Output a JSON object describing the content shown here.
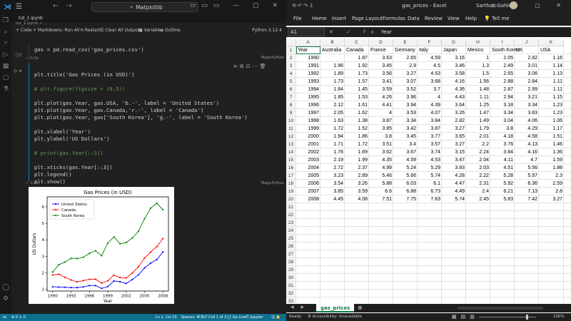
{
  "vscode": {
    "title_search": "Matplotlib",
    "tabs": [
      "tut_1.ipynb",
      "tut_1.ipynb > ..."
    ],
    "toolbar": [
      "+ Code",
      "+ Markdown",
      "▷ Run All",
      "⟲ Restart",
      "☰ Clear All Outputs",
      "▦ Variables",
      "≡ Outline",
      "Python 3.12.4"
    ],
    "cell1": {
      "index": "[2]",
      "lines": [
        "gas = pd.read_csv('gas_prices.csv')"
      ],
      "status": "✓ 0.0s",
      "lang": "MagicPython"
    },
    "cell2": {
      "index": "[3]",
      "lines": [
        "plt.title('Gas Prices (in USD)')",
        "",
        "# plt.figure(figsize = (8,5))",
        "",
        "plt.plot(gas.Year, gas.USA, 'b.-', label = 'United States')",
        "plt.plot(gas.Year, gas.Canada,'r.-', label = 'Canada')",
        "plt.plot(gas.Year, gas['South Korea'], 'g.-', label = 'South Korea')",
        "",
        "plt.xlabel('Year')",
        "plt.ylabel('US Dollars')",
        "",
        "# print(gas.Year[::3])",
        "",
        "plt.xticks(gas.Year[::3])",
        "plt.legend()",
        "plt.show()"
      ],
      "status": "✓ 0.0s",
      "lang": "MagicPython"
    },
    "statusbar": [
      "⊗ 0  ⚠ 0",
      "Ln 1, Col 15",
      "Spaces: 4",
      "CRLF",
      "Cell 1 of 2",
      "{} Go Live",
      "Ⓟ Jupyter",
      "☺ 🔔"
    ]
  },
  "chart_data": {
    "type": "line",
    "title": "Gas Prices (in USD)",
    "xlabel": "Year",
    "ylabel": "US Dollars",
    "x": [
      1990,
      1991,
      1992,
      1993,
      1994,
      1995,
      1996,
      1997,
      1998,
      1999,
      2000,
      2001,
      2002,
      2003,
      2004,
      2005,
      2006,
      2007,
      2008
    ],
    "xticks": [
      1990,
      1993,
      1996,
      1999,
      2002,
      2005,
      2008
    ],
    "yticks": [
      1,
      2,
      3,
      4,
      5,
      6
    ],
    "xlim": [
      1989.1,
      2008.9
    ],
    "ylim": [
      0.9,
      6.6
    ],
    "legend_position": "top-left",
    "grid": false,
    "series": [
      {
        "name": "United States",
        "color": "#0000ff",
        "values": [
          1.16,
          1.14,
          1.13,
          1.11,
          1.11,
          1.15,
          1.23,
          1.23,
          1.06,
          1.17,
          1.51,
          1.46,
          1.36,
          1.59,
          1.88,
          2.3,
          2.59,
          2.8,
          3.27
        ]
      },
      {
        "name": "Canada",
        "color": "#ff0000",
        "values": [
          1.87,
          1.92,
          1.73,
          1.57,
          1.45,
          1.53,
          1.61,
          1.62,
          1.38,
          1.52,
          1.86,
          1.72,
          1.69,
          1.99,
          2.37,
          2.89,
          3.26,
          3.59,
          4.08
        ]
      },
      {
        "name": "South Korea",
        "color": "#008000",
        "values": [
          2.05,
          2.49,
          2.65,
          2.88,
          2.87,
          2.94,
          3.18,
          3.34,
          3.04,
          3.8,
          4.18,
          3.76,
          3.84,
          4.11,
          4.51,
          5.28,
          5.92,
          6.21,
          5.83
        ]
      }
    ]
  },
  "excel": {
    "title": "gas_prices  -  Excel",
    "user": "Sarthak Gahlot",
    "quick_access": "⟲  ↶  ↷  ⇩",
    "ribbon": [
      "File",
      "Home",
      "Insert",
      "Page Layout",
      "Formulas",
      "Data",
      "Review",
      "View",
      "Help",
      "💡 Tell me"
    ],
    "name_box": "A1",
    "formula_icons": "✕ ✓ fx",
    "formula_value": "Year",
    "columns": [
      "A",
      "B",
      "C",
      "D",
      "E",
      "F",
      "G",
      "H",
      "I",
      "J",
      "K"
    ],
    "headers": [
      "Year",
      "Australia",
      "Canada",
      "France",
      "Germany",
      "Italy",
      "Japan",
      "Mexico",
      "South Korea",
      "UK",
      "USA"
    ],
    "rows": [
      [
        "1990",
        "",
        "1.87",
        "3.63",
        "2.65",
        "4.59",
        "3.16",
        "1",
        "2.05",
        "2.82",
        "1.16"
      ],
      [
        "1991",
        "1.96",
        "1.92",
        "3.45",
        "2.9",
        "4.5",
        "3.46",
        "1.3",
        "2.49",
        "3.01",
        "1.14"
      ],
      [
        "1992",
        "1.89",
        "1.73",
        "3.56",
        "3.27",
        "4.53",
        "3.58",
        "1.5",
        "2.65",
        "3.06",
        "1.13"
      ],
      [
        "1993",
        "1.73",
        "1.57",
        "3.41",
        "3.07",
        "3.68",
        "4.16",
        "1.56",
        "2.88",
        "2.84",
        "1.11"
      ],
      [
        "1994",
        "1.84",
        "1.45",
        "3.59",
        "3.52",
        "3.7",
        "4.36",
        "1.48",
        "2.87",
        "2.99",
        "1.11"
      ],
      [
        "1995",
        "1.95",
        "1.53",
        "4.26",
        "3.96",
        "4",
        "4.43",
        "1.11",
        "2.94",
        "3.21",
        "1.15"
      ],
      [
        "1996",
        "2.12",
        "1.61",
        "4.41",
        "3.94",
        "4.39",
        "3.64",
        "1.25",
        "3.18",
        "3.34",
        "1.23"
      ],
      [
        "1997",
        "2.05",
        "1.62",
        "4",
        "3.53",
        "4.07",
        "3.26",
        "1.47",
        "3.34",
        "3.83",
        "1.23"
      ],
      [
        "1998",
        "1.63",
        "1.38",
        "3.87",
        "3.34",
        "3.84",
        "2.82",
        "1.49",
        "3.04",
        "4.06",
        "1.06"
      ],
      [
        "1999",
        "1.72",
        "1.52",
        "3.85",
        "3.42",
        "3.87",
        "3.27",
        "1.79",
        "3.8",
        "4.29",
        "1.17"
      ],
      [
        "2000",
        "1.94",
        "1.86",
        "3.8",
        "3.45",
        "3.77",
        "3.65",
        "2.01",
        "4.18",
        "4.58",
        "1.51"
      ],
      [
        "2001",
        "1.71",
        "1.72",
        "3.51",
        "3.4",
        "3.57",
        "3.27",
        "2.2",
        "3.76",
        "4.13",
        "1.46"
      ],
      [
        "2002",
        "1.76",
        "1.69",
        "3.62",
        "3.67",
        "3.74",
        "3.15",
        "2.24",
        "3.84",
        "4.16",
        "1.36"
      ],
      [
        "2003",
        "2.19",
        "1.99",
        "4.35",
        "4.59",
        "4.53",
        "3.47",
        "2.04",
        "4.11",
        "4.7",
        "1.59"
      ],
      [
        "2004",
        "2.72",
        "2.37",
        "4.99",
        "5.24",
        "5.29",
        "3.93",
        "2.03",
        "4.51",
        "5.56",
        "1.88"
      ],
      [
        "2005",
        "3.23",
        "2.89",
        "5.46",
        "5.66",
        "5.74",
        "4.28",
        "2.22",
        "5.28",
        "5.97",
        "2.3"
      ],
      [
        "2006",
        "3.54",
        "3.26",
        "5.88",
        "6.03",
        "6.1",
        "4.47",
        "2.31",
        "5.92",
        "6.36",
        "2.59"
      ],
      [
        "2007",
        "3.85",
        "3.59",
        "6.6",
        "6.88",
        "6.73",
        "4.49",
        "2.4",
        "6.21",
        "7.13",
        "2.8"
      ],
      [
        "2008",
        "4.45",
        "4.08",
        "7.51",
        "7.75",
        "7.63",
        "5.74",
        "2.45",
        "5.83",
        "7.42",
        "3.27"
      ]
    ],
    "row_count": 36,
    "sheet_tab": "gas_prices",
    "status_left": "Ready",
    "status_access": "⚙ Accessibility: Unavailable",
    "zoom": "100%",
    "colors": {
      "sheet_tab": "#107c41",
      "status_bar": "#0e6f8f"
    }
  }
}
